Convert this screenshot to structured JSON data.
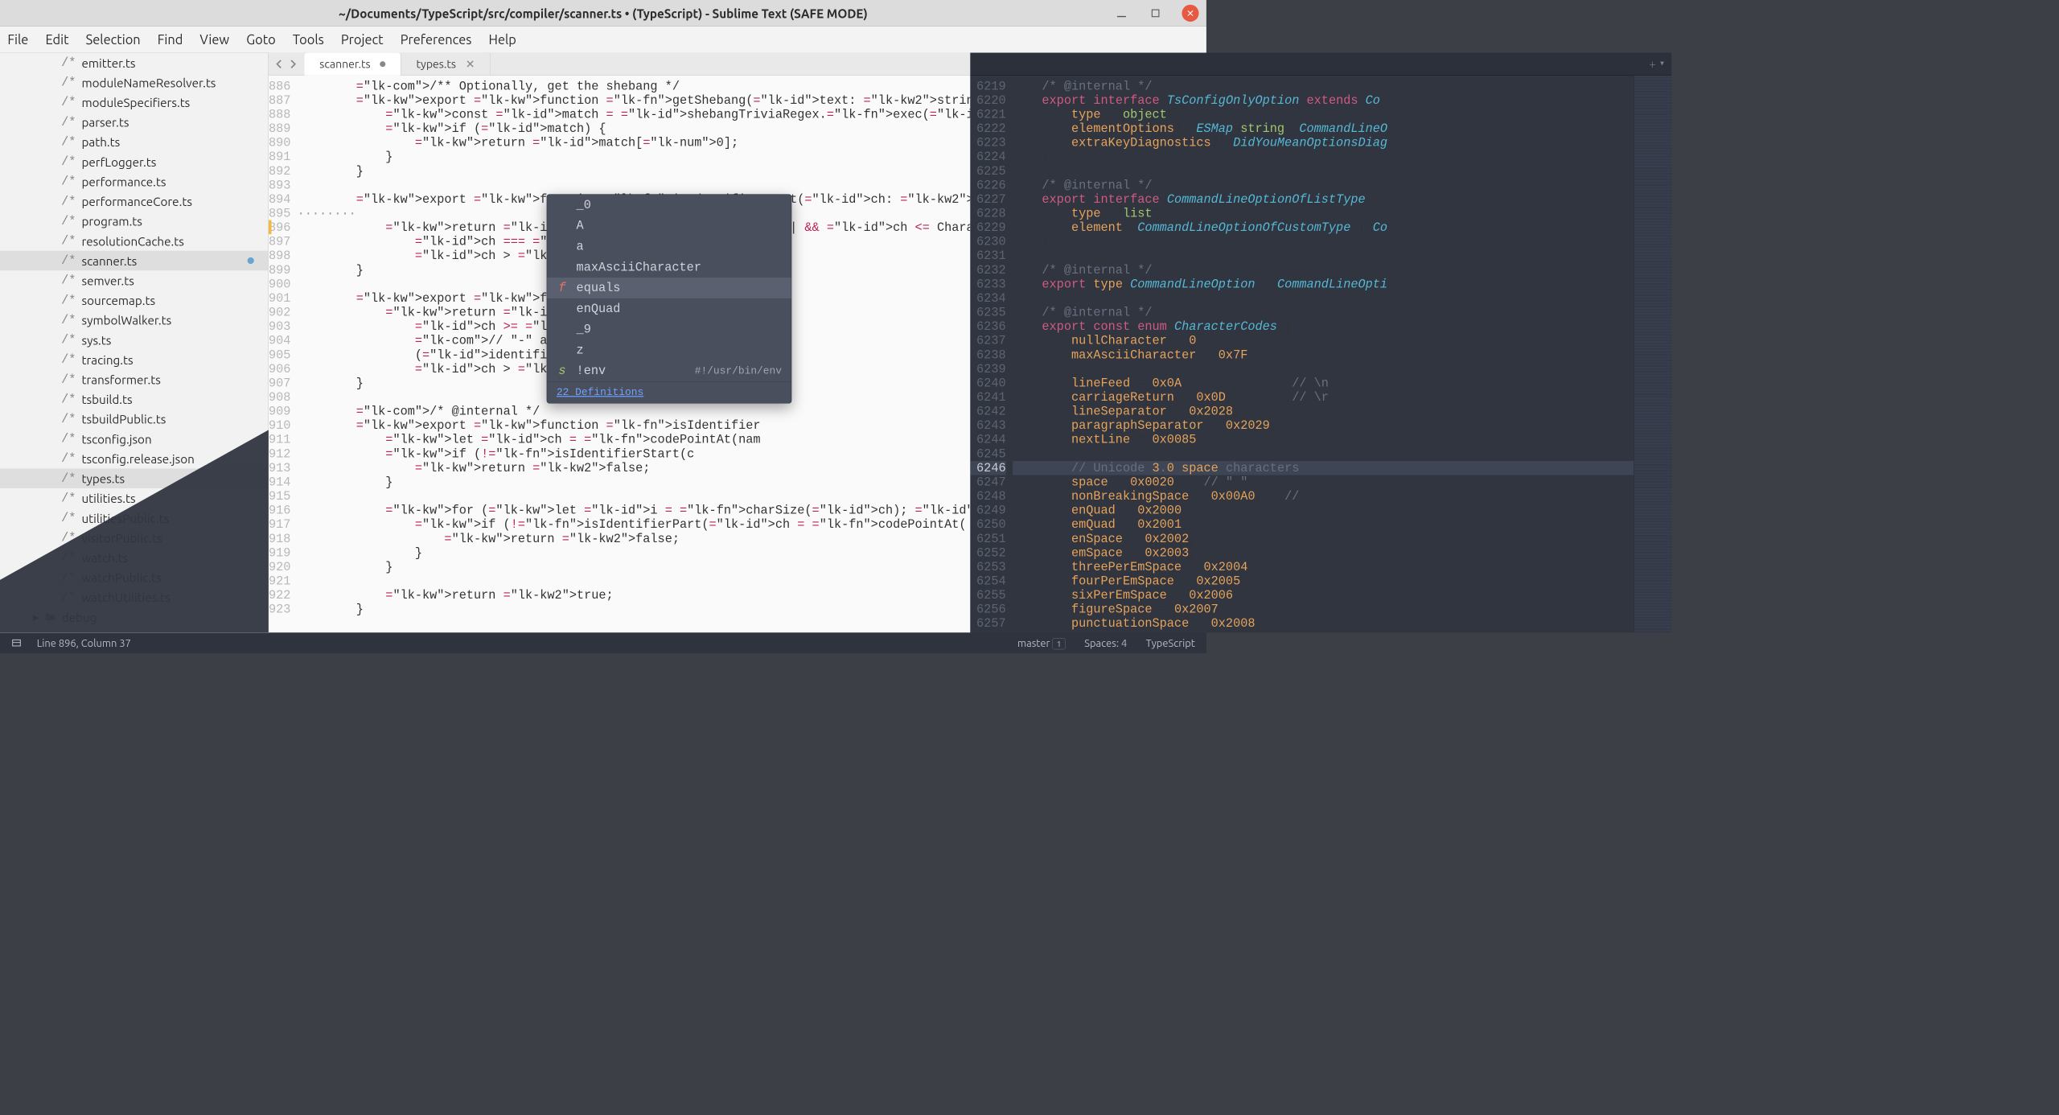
{
  "window": {
    "title": "~/Documents/TypeScript/src/compiler/scanner.ts • (TypeScript) - Sublime Text (SAFE MODE)"
  },
  "menu": [
    "File",
    "Edit",
    "Selection",
    "Find",
    "View",
    "Goto",
    "Tools",
    "Project",
    "Preferences",
    "Help"
  ],
  "sidebar": {
    "files": [
      "emitter.ts",
      "moduleNameResolver.ts",
      "moduleSpecifiers.ts",
      "parser.ts",
      "path.ts",
      "perfLogger.ts",
      "performance.ts",
      "performanceCore.ts",
      "program.ts",
      "resolutionCache.ts",
      "scanner.ts",
      "semver.ts",
      "sourcemap.ts",
      "symbolWalker.ts",
      "sys.ts",
      "tracing.ts",
      "transformer.ts",
      "tsbuild.ts",
      "tsbuildPublic.ts",
      "tsconfig.json",
      "tsconfig.release.json",
      "types.ts",
      "utilities.ts",
      "utilitiesPublic.ts",
      "visitorPublic.ts",
      "watch.ts",
      "watchPublic.ts",
      "watchUtilities.ts"
    ],
    "active_file": "scanner.ts",
    "secondary_selected": "types.ts",
    "folder": "debug"
  },
  "left_pane": {
    "tabs": [
      {
        "label": "scanner.ts",
        "dirty": true,
        "active": true
      },
      {
        "label": "types.ts",
        "dirty": false,
        "active": false
      }
    ],
    "first_line": 886,
    "current_line": 896,
    "lines": [
      "/** Optionally, get the shebang */",
      "export function getShebang(text: string): string",
      "    const match = shebangTriviaRegex.exec(text);",
      "    if (match) {",
      "        return match[0];",
      "    }",
      "}",
      "",
      "export function isIdentifierStart(ch: number, l",
      "........",
      "    return ch >= CharacterCodes.| && ch <= Chara",
      "        ch === CharacterCode",
      "        ch > CharacterCodes.",
      "}",
      "",
      "export function isIdentifier",
      "    return ch >= CharacterCo",
      "        ch >= CharacterCodes",
      "        // \"-\" and \":\" are v",
      "        (identifierVariant =",
      "        ch > CharacterCodes.",
      "}",
      "",
      "/* @internal */",
      "export function isIdentifier",
      "    let ch = codePointAt(nam",
      "    if (!isIdentifierStart(c",
      "        return false;",
      "    }",
      "",
      "    for (let i = charSize(ch); i < name.length;",
      "        if (!isIdentifierPart(ch = codePointAt(",
      "            return false;",
      "        }",
      "    }",
      "",
      "    return true;",
      "}",
      ""
    ]
  },
  "autocomplete": {
    "items": [
      {
        "kind": "",
        "label": "_0"
      },
      {
        "kind": "",
        "label": "A"
      },
      {
        "kind": "",
        "label": "a"
      },
      {
        "kind": "",
        "label": "maxAsciiCharacter"
      },
      {
        "kind": "f",
        "label": "equals",
        "selected": true
      },
      {
        "kind": "",
        "label": "enQuad"
      },
      {
        "kind": "",
        "label": "_9"
      },
      {
        "kind": "",
        "label": "z"
      },
      {
        "kind": "s",
        "label": "!env",
        "right": "#!/usr/bin/env"
      }
    ],
    "footer": "22 Definitions"
  },
  "right_pane": {
    "tabs": [],
    "first_line": 6219,
    "highlight_line": 6246,
    "lines": [
      "/* @internal */",
      "export interface TsConfigOnlyOption extends Co",
      "    type: \"object\";",
      "    elementOptions?: ESMap<string, CommandLineO",
      "    extraKeyDiagnostics?: DidYouMeanOptionsDiag",
      "}",
      "",
      "/* @internal */",
      "export interface CommandLineOptionOfListType e",
      "    type: \"list\";",
      "    element: CommandLineOptionOfCustomType | Co",
      "}",
      "",
      "/* @internal */",
      "export type CommandLineOption = CommandLineOpti",
      "",
      "/* @internal */",
      "export const enum CharacterCodes {",
      "    nullCharacter = 0,",
      "    maxAsciiCharacter = 0x7F,",
      "",
      "    lineFeed = 0x0A,              // \\n",
      "    carriageReturn = 0x0D,        // \\r",
      "    lineSeparator = 0x2028,",
      "    paragraphSeparator = 0x2029,",
      "    nextLine = 0x0085,",
      "",
      "    // Unicode 3.0 space characters",
      "    space = 0x0020,   // \" \"",
      "    nonBreakingSpace = 0x00A0,   //",
      "    enQuad = 0x2000,",
      "    emQuad = 0x2001,",
      "    enSpace = 0x2002,",
      "    emSpace = 0x2003,",
      "    threePerEmSpace = 0x2004,",
      "    fourPerEmSpace = 0x2005,",
      "    sixPerEmSpace = 0x2006,",
      "    figureSpace = 0x2007,",
      "    punctuationSpace = 0x2008,"
    ]
  },
  "status": {
    "left": "Line 896, Column 37",
    "branch": "master",
    "branch_count": "1",
    "spaces": "Spaces: 4",
    "lang": "TypeScript"
  }
}
